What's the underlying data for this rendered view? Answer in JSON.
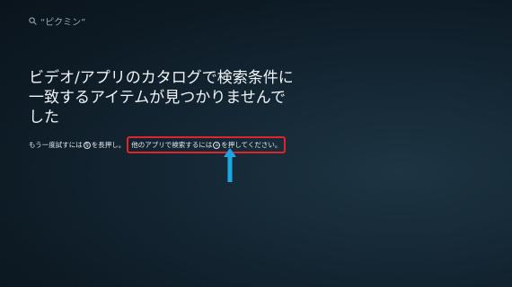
{
  "search": {
    "query": "“ピクミン”",
    "icon": "search-icon"
  },
  "main": {
    "headline": "ビデオ/アプリのカタログで検索条件に一致するアイテムが見つかりませんでした",
    "hint_part1": "もう一度試すには",
    "mic_glyph": "🎙",
    "hint_part2": "を長押し。",
    "hint_highlight_part1": "他のアプリで検索するには",
    "home_glyph": "⌂",
    "hint_highlight_part2": "を押してください。"
  },
  "annotation": {
    "highlight_color": "#e0242a",
    "arrow_color": "#1ca6e6"
  }
}
